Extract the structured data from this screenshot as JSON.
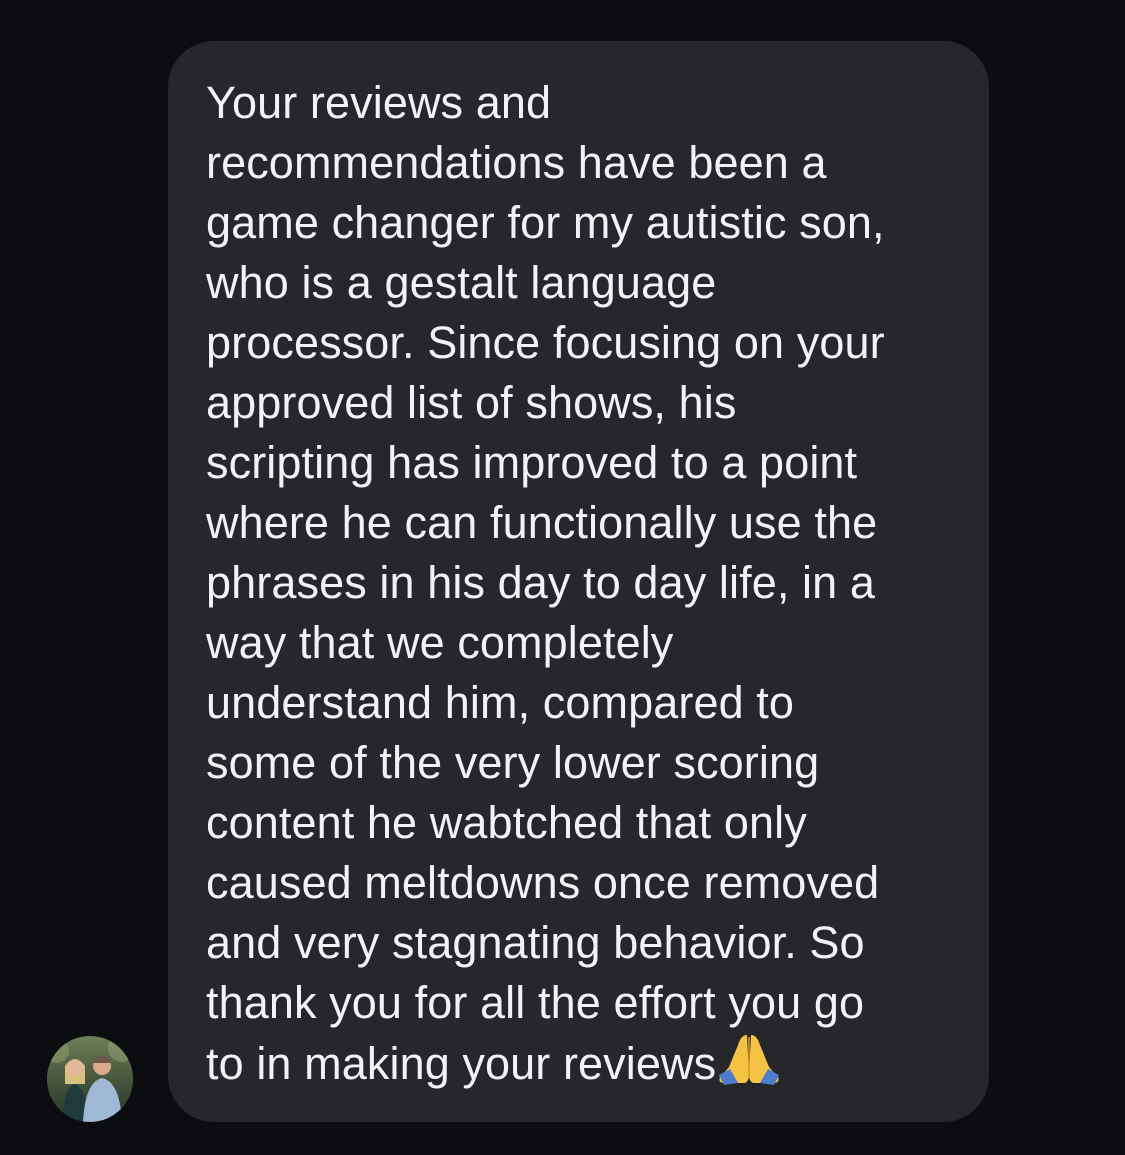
{
  "message": {
    "lines": [
      "Your reviews and",
      "recommendations have been a",
      "game changer for my autistic son,",
      "who is a gestalt language",
      "processor. Since focusing on your",
      "approved list of shows, his",
      "scripting has improved to a point",
      "where he can functionally use the",
      "phrases in his day to day life, in a",
      "way that we completely",
      "understand him, compared to",
      "some of the very lower scoring",
      "content he wabtched that only",
      "caused meltdowns once removed",
      "and very stagnating behavior. So",
      "thank you for all the effort you go",
      "to in making your reviews"
    ],
    "emoji": "folded-hands-icon"
  },
  "sender": {
    "avatar_icon": "profile-photo"
  },
  "colors": {
    "background": "#0c0d11",
    "bubble": "#25272b",
    "text": "#f2f2f4"
  }
}
